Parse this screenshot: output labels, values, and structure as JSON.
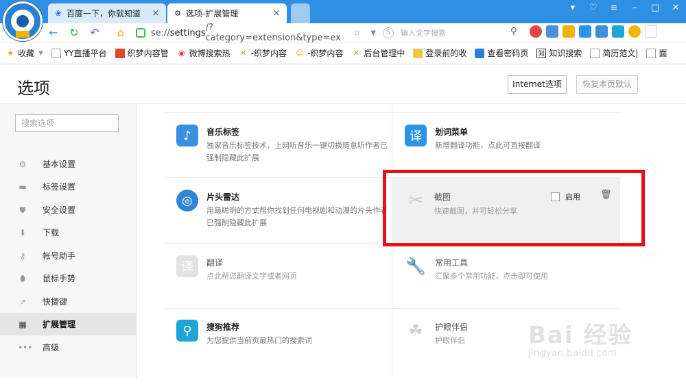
{
  "tabs": [
    {
      "title": "百度一下，你就知道",
      "close": "×"
    },
    {
      "title": "选项-扩展管理",
      "close": "×"
    }
  ],
  "window_controls": [
    "▾",
    "♡",
    "≡",
    "–",
    "□",
    "✕"
  ],
  "address": {
    "prefix": "se://",
    "bold": "settings",
    "rest": "/?category=extension&type=ex"
  },
  "search": {
    "placeholder": "输入文字搜索"
  },
  "bookmarks": [
    "收藏",
    "YY直播平台",
    "织梦内容管",
    "微博搜索热",
    "-织梦内容",
    "-织梦内容",
    "后台管理中",
    "登录前的收",
    "查看密码页",
    "知识搜索",
    "简历范文|",
    "面"
  ],
  "header": {
    "title": "选项",
    "ie_button": "Internet选项",
    "reset_button": "恢复本页默认"
  },
  "sidebar": {
    "search_placeholder": "搜索选项",
    "items": [
      {
        "label": "基本设置",
        "icon": "gear-icon"
      },
      {
        "label": "标签设置",
        "icon": "tab-icon"
      },
      {
        "label": "安全设置",
        "icon": "shield-icon"
      },
      {
        "label": "下载",
        "icon": "download-icon"
      },
      {
        "label": "帐号助手",
        "icon": "key-icon"
      },
      {
        "label": "鼠标手势",
        "icon": "mouse-icon"
      },
      {
        "label": "快捷键",
        "icon": "arrow-icon"
      },
      {
        "label": "扩展管理",
        "icon": "grid-icon",
        "active": true
      },
      {
        "label": "高级",
        "icon": "dots-icon"
      }
    ]
  },
  "extensions": [
    {
      "name": "音乐标签",
      "desc": "独家音乐标签技术，上网听音乐一键切换随意听作者已强制隐藏此扩展",
      "icon": "music-icon",
      "color": "#3b8fe0"
    },
    {
      "name": "划词菜单",
      "desc": "新增翻译功能，点此可直接翻译",
      "icon": "translate-icon",
      "color": "#2b93e8"
    },
    {
      "name": "片头雷达",
      "desc": "用最聪明的方式帮你找到任何电视剧和动漫的片头作者已强制隐藏此扩展",
      "icon": "radar-icon",
      "color": "#2f86d8"
    },
    {
      "name": "截图",
      "desc": "快速截图，并可轻松分享",
      "icon": "scissors-icon",
      "color": "#c8c8c8",
      "enable_label": "启用"
    },
    {
      "name": "翻译",
      "desc": "点此帮您翻译文字或者网页",
      "icon": "translate-icon",
      "color": "#d6d6d6"
    },
    {
      "name": "常用工具",
      "desc": "汇聚多个常用功能，点击即可使用",
      "icon": "wrench-icon",
      "color": "#bdbdbd"
    },
    {
      "name": "搜狗推荐",
      "desc": "为您提供当前页最热门的搜索词",
      "icon": "search-icon",
      "color": "#1ea5d6"
    },
    {
      "name": "护眼伴侣",
      "desc": "护眼伴侣",
      "icon": "eye-icon",
      "color": "#cfcfcf"
    }
  ],
  "watermark": {
    "text": "Bai 经验",
    "url": "jingyan.baidu.com"
  }
}
